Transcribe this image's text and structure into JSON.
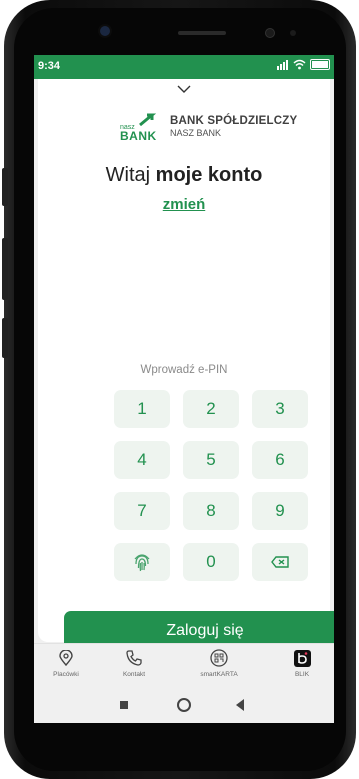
{
  "status": {
    "time": "9:34"
  },
  "brand": {
    "line1": "BANK SPÓŁDZIELCZY",
    "line2": "NASZ BANK",
    "mark_small": "nasz",
    "mark_big": "BANK",
    "color": "#22914f"
  },
  "greeting": {
    "prefix": "Witaj ",
    "name": "moje konto"
  },
  "change_link": "zmień",
  "pin": {
    "label": "Wprowadź e-PIN"
  },
  "keypad": [
    "1",
    "2",
    "3",
    "4",
    "5",
    "6",
    "7",
    "8",
    "9",
    "0"
  ],
  "login_button": "Zaloguj się",
  "tabs": [
    {
      "label": "Placówki",
      "icon": "location-pin-icon"
    },
    {
      "label": "Kontakt",
      "icon": "phone-icon"
    },
    {
      "label": "smartKARTA",
      "icon": "smartkarta-icon"
    },
    {
      "label": "BLIK",
      "icon": "blik-icon"
    }
  ]
}
